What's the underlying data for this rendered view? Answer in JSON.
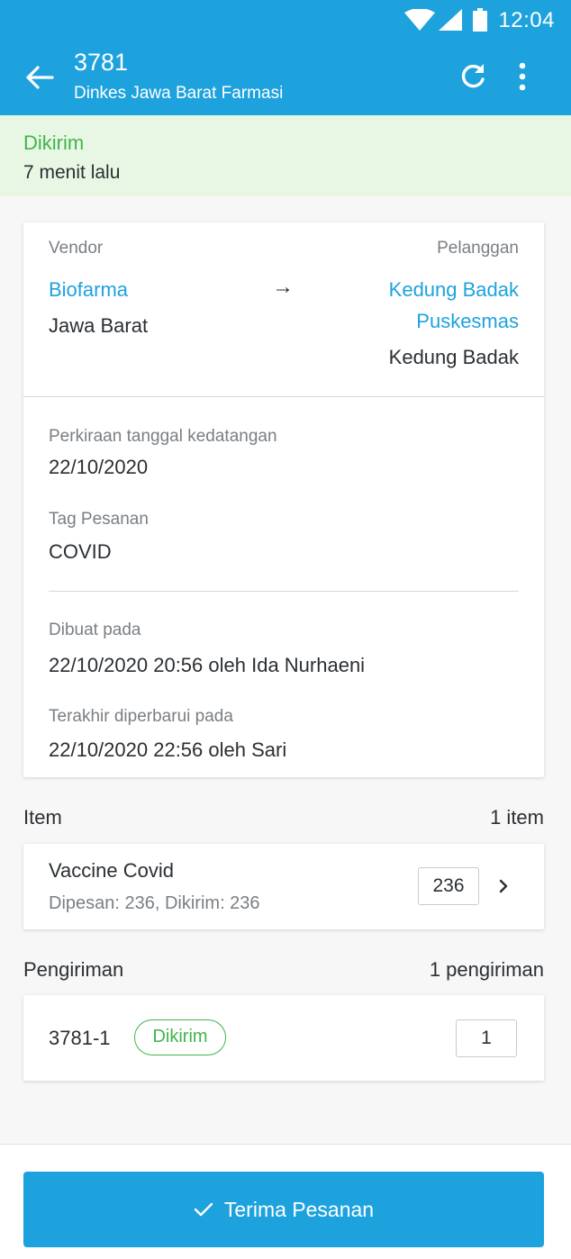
{
  "status_bar": {
    "time": "12:04"
  },
  "app_bar": {
    "title": "3781",
    "subtitle": "Dinkes Jawa Barat Farmasi"
  },
  "status_banner": {
    "state": "Dikirim",
    "ago": "7 menit lalu"
  },
  "parties": {
    "vendor_label": "Vendor",
    "vendor_name": "Biofarma",
    "vendor_region": "Jawa Barat",
    "arrow": "→",
    "customer_label": "Pelanggan",
    "customer_name_line1": "Kedung Badak",
    "customer_name_line2": "Puskesmas",
    "customer_region": "Kedung Badak"
  },
  "details": {
    "eta_label": "Perkiraan tanggal kedatangan",
    "eta_value": "22/10/2020",
    "tag_label": "Tag Pesanan",
    "tag_value": "COVID",
    "created_label": "Dibuat pada",
    "created_value": "22/10/2020 20:56 oleh Ida Nurhaeni",
    "updated_label": "Terakhir diperbarui pada",
    "updated_value": "22/10/2020 22:56 oleh Sari"
  },
  "items": {
    "title": "Item",
    "count": "1 item",
    "list": [
      {
        "name": "Vaccine Covid",
        "meta": "Dipesan: 236, Dikirim: 236",
        "qty": "236"
      }
    ]
  },
  "shipments": {
    "title": "Pengiriman",
    "count": "1 pengiriman",
    "list": [
      {
        "id": "3781-1",
        "status": "Dikirim",
        "qty": "1"
      }
    ]
  },
  "action": {
    "label": "Terima Pesanan"
  },
  "colors": {
    "primary": "#1ea2de",
    "success": "#3fb54a",
    "banner_bg": "#e8f7e4"
  }
}
